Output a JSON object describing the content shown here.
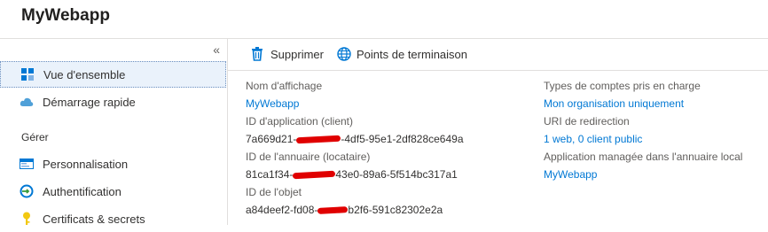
{
  "app": {
    "title": "MyWebapp"
  },
  "sidebar": {
    "collapse_glyph": "«",
    "items": [
      {
        "label": "Vue d'ensemble",
        "icon": "overview-icon"
      },
      {
        "label": "Démarrage rapide",
        "icon": "cloud-icon"
      }
    ],
    "section_label": "Gérer",
    "manage_items": [
      {
        "label": "Personnalisation",
        "icon": "branding-icon"
      },
      {
        "label": "Authentification",
        "icon": "authentication-icon"
      },
      {
        "label": "Certificats & secrets",
        "icon": "key-icon"
      }
    ]
  },
  "toolbar": {
    "delete_label": "Supprimer",
    "endpoints_label": "Points de terminaison"
  },
  "properties": {
    "display_name_label": "Nom d'affichage",
    "display_name_value": "MyWebapp",
    "app_id_label": "ID d'application (client)",
    "app_id_prefix": "7a669d21-",
    "app_id_suffix": "-4df5-95e1-2df828ce649a",
    "directory_id_label": "ID de l'annuaire (locataire)",
    "directory_id_prefix": "81ca1f34-",
    "directory_id_suffix": "43e0-89a6-5f514bc317a1",
    "object_id_label": "ID de l'objet",
    "object_id_prefix": "a84deef2-fd08-",
    "object_id_suffix": "b2f6-591c82302e2a",
    "account_types_label": "Types de comptes pris en charge",
    "account_types_value": "Mon organisation uniquement",
    "redirect_uri_label": "URI de redirection",
    "redirect_uri_value": "1 web, 0 client public",
    "managed_app_label": "Application managée dans l'annuaire local",
    "managed_app_value": "MyWebapp"
  },
  "colors": {
    "accent": "#0078d4",
    "redaction": "#e00000",
    "active_bg": "#eaf2fb"
  }
}
